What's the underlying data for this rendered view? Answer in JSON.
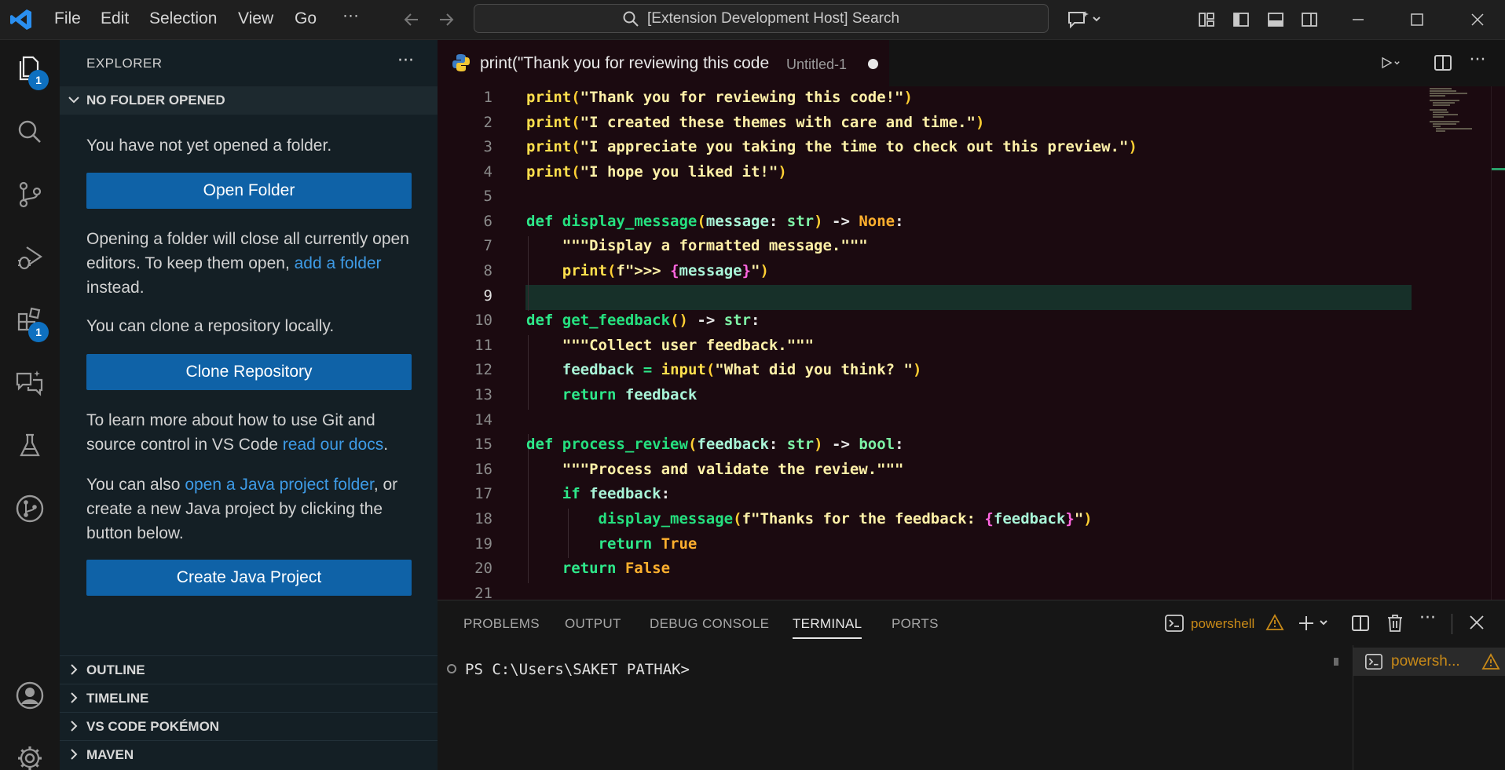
{
  "titlebar": {
    "menus": [
      "File",
      "Edit",
      "Selection",
      "View",
      "Go"
    ],
    "more": "···",
    "search_text": "[Extension Development Host] Search",
    "icons": [
      "vscode-logo-icon",
      "back-arrow-icon",
      "forward-arrow-icon",
      "copilot-icon",
      "layout-icon",
      "minimize-icon",
      "maximize-icon",
      "close-icon"
    ]
  },
  "activitybar": {
    "explorer_badge": "1",
    "extensions_badge": "1",
    "icons": [
      "files-icon",
      "search-icon",
      "source-control-icon",
      "run-debug-icon",
      "extensions-icon",
      "chat-icon",
      "testing-icon",
      "git-graph-icon",
      "account-icon",
      "settings-gear-icon"
    ]
  },
  "sidebar": {
    "title": "EXPLORER",
    "more": "···",
    "section": "NO FOLDER OPENED",
    "p1": "You have not yet opened a folder.",
    "open_folder": "Open Folder",
    "p2_a": "Opening a folder will close all currently open editors. To keep them open, ",
    "p2_link": "add a folder",
    "p2_b": " instead.",
    "p3": "You can clone a repository locally.",
    "clone_repo": "Clone Repository",
    "p4_a": "To learn more about how to use Git and source control in VS Code ",
    "p4_link": "read our docs",
    "p4_b": ".",
    "p5_a": "You can also ",
    "p5_link": "open a Java project folder",
    "p5_b": ", or create a new Java project by clicking the button below.",
    "create_java": "Create Java Project",
    "bottom_sections": [
      "OUTLINE",
      "TIMELINE",
      "VS CODE POKÉMON",
      "MAVEN"
    ]
  },
  "editor": {
    "tab_label": "print(\"Thank you for reviewing this code",
    "tab_desc": "Untitled-1",
    "line_numbers": [
      "1",
      "2",
      "3",
      "4",
      "5",
      "6",
      "7",
      "8",
      "9",
      "10",
      "11",
      "12",
      "13",
      "14",
      "15",
      "16",
      "17",
      "18",
      "19",
      "20",
      "21"
    ],
    "current_line": "9",
    "colors": {
      "background": "#1b0a10",
      "keyword": "#2ee88a",
      "string": "#fff1a8",
      "builtin": "#ffe04d"
    }
  },
  "panel": {
    "tabs": [
      "PROBLEMS",
      "OUTPUT",
      "DEBUG CONSOLE",
      "TERMINAL",
      "PORTS"
    ],
    "active_tab": "TERMINAL",
    "shell_label": "powershell",
    "prompt": "PS C:\\Users\\SAKET PATHAK>",
    "terminal_entry": "powersh..."
  }
}
